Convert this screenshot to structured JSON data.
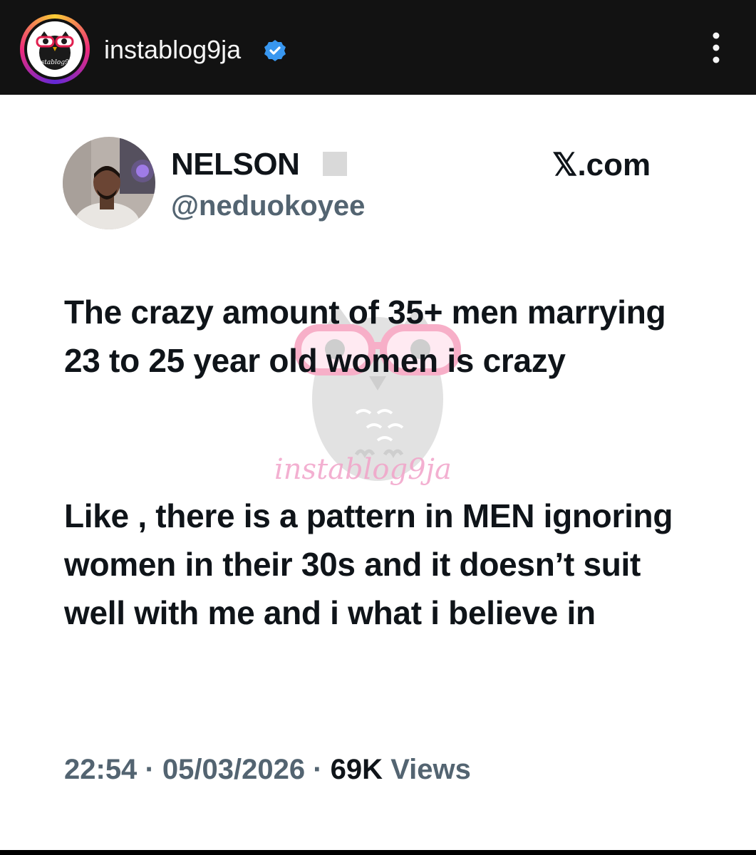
{
  "header": {
    "account_name": "instablog9ja",
    "avatar_logo_text": "instablog9ja",
    "verified": true,
    "accent_color": "#3897f0"
  },
  "tweet": {
    "display_name": "NELSON",
    "username": "@neduokoyee",
    "source": "𝕏.com",
    "paragraphs": [
      "The crazy amount of 35+ men marrying 23 to 25 year old women is crazy",
      "Like , there is a pattern in  MEN ignoring women in their 30s and it doesn’t suit well with me and i what i believe in"
    ],
    "time": "22:54",
    "separator": "·",
    "date": "05/03/2026",
    "views_count": "69K",
    "views_label": "Views"
  },
  "watermark": {
    "text": "instablog9ja"
  },
  "colors": {
    "text_primary": "#0f1419",
    "text_secondary": "#536471",
    "header_bg": "#121212",
    "watermark_pink": "#f2a3c9"
  }
}
